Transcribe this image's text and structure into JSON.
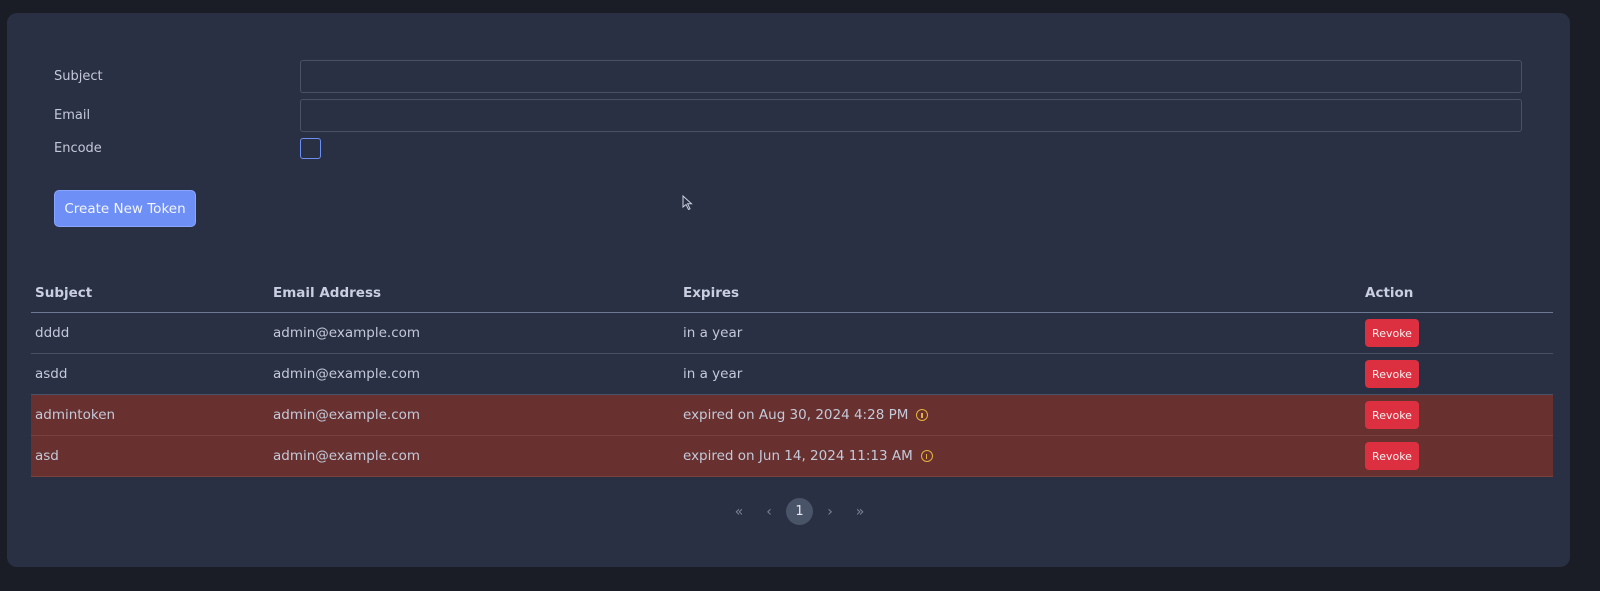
{
  "form": {
    "subject_label": "Subject",
    "subject_value": "",
    "email_label": "Email",
    "email_value": "",
    "encode_label": "Encode",
    "encode_checked": false,
    "create_button": "Create New Token"
  },
  "table": {
    "headers": [
      "Subject",
      "Email Address",
      "Expires",
      "Action"
    ],
    "rows": [
      {
        "subject": "dddd",
        "email": "admin@example.com",
        "expires": "in a year",
        "expired": false,
        "action": "Revoke"
      },
      {
        "subject": "asdd",
        "email": "admin@example.com",
        "expires": "in a year",
        "expired": false,
        "action": "Revoke"
      },
      {
        "subject": "admintoken",
        "email": "admin@example.com",
        "expires": "expired on Aug 30, 2024 4:28 PM",
        "expired": true,
        "action": "Revoke"
      },
      {
        "subject": "asd",
        "email": "admin@example.com",
        "expires": "expired on Jun 14, 2024 11:13 AM",
        "expired": true,
        "action": "Revoke"
      }
    ]
  },
  "pagination": {
    "first": "«",
    "prev": "‹",
    "current": "1",
    "next": "›",
    "last": "»"
  },
  "colors": {
    "accent": "#6e8ff5",
    "danger": "#dc3040",
    "expired_row": "#683130",
    "warning_icon": "#e3b23c"
  }
}
